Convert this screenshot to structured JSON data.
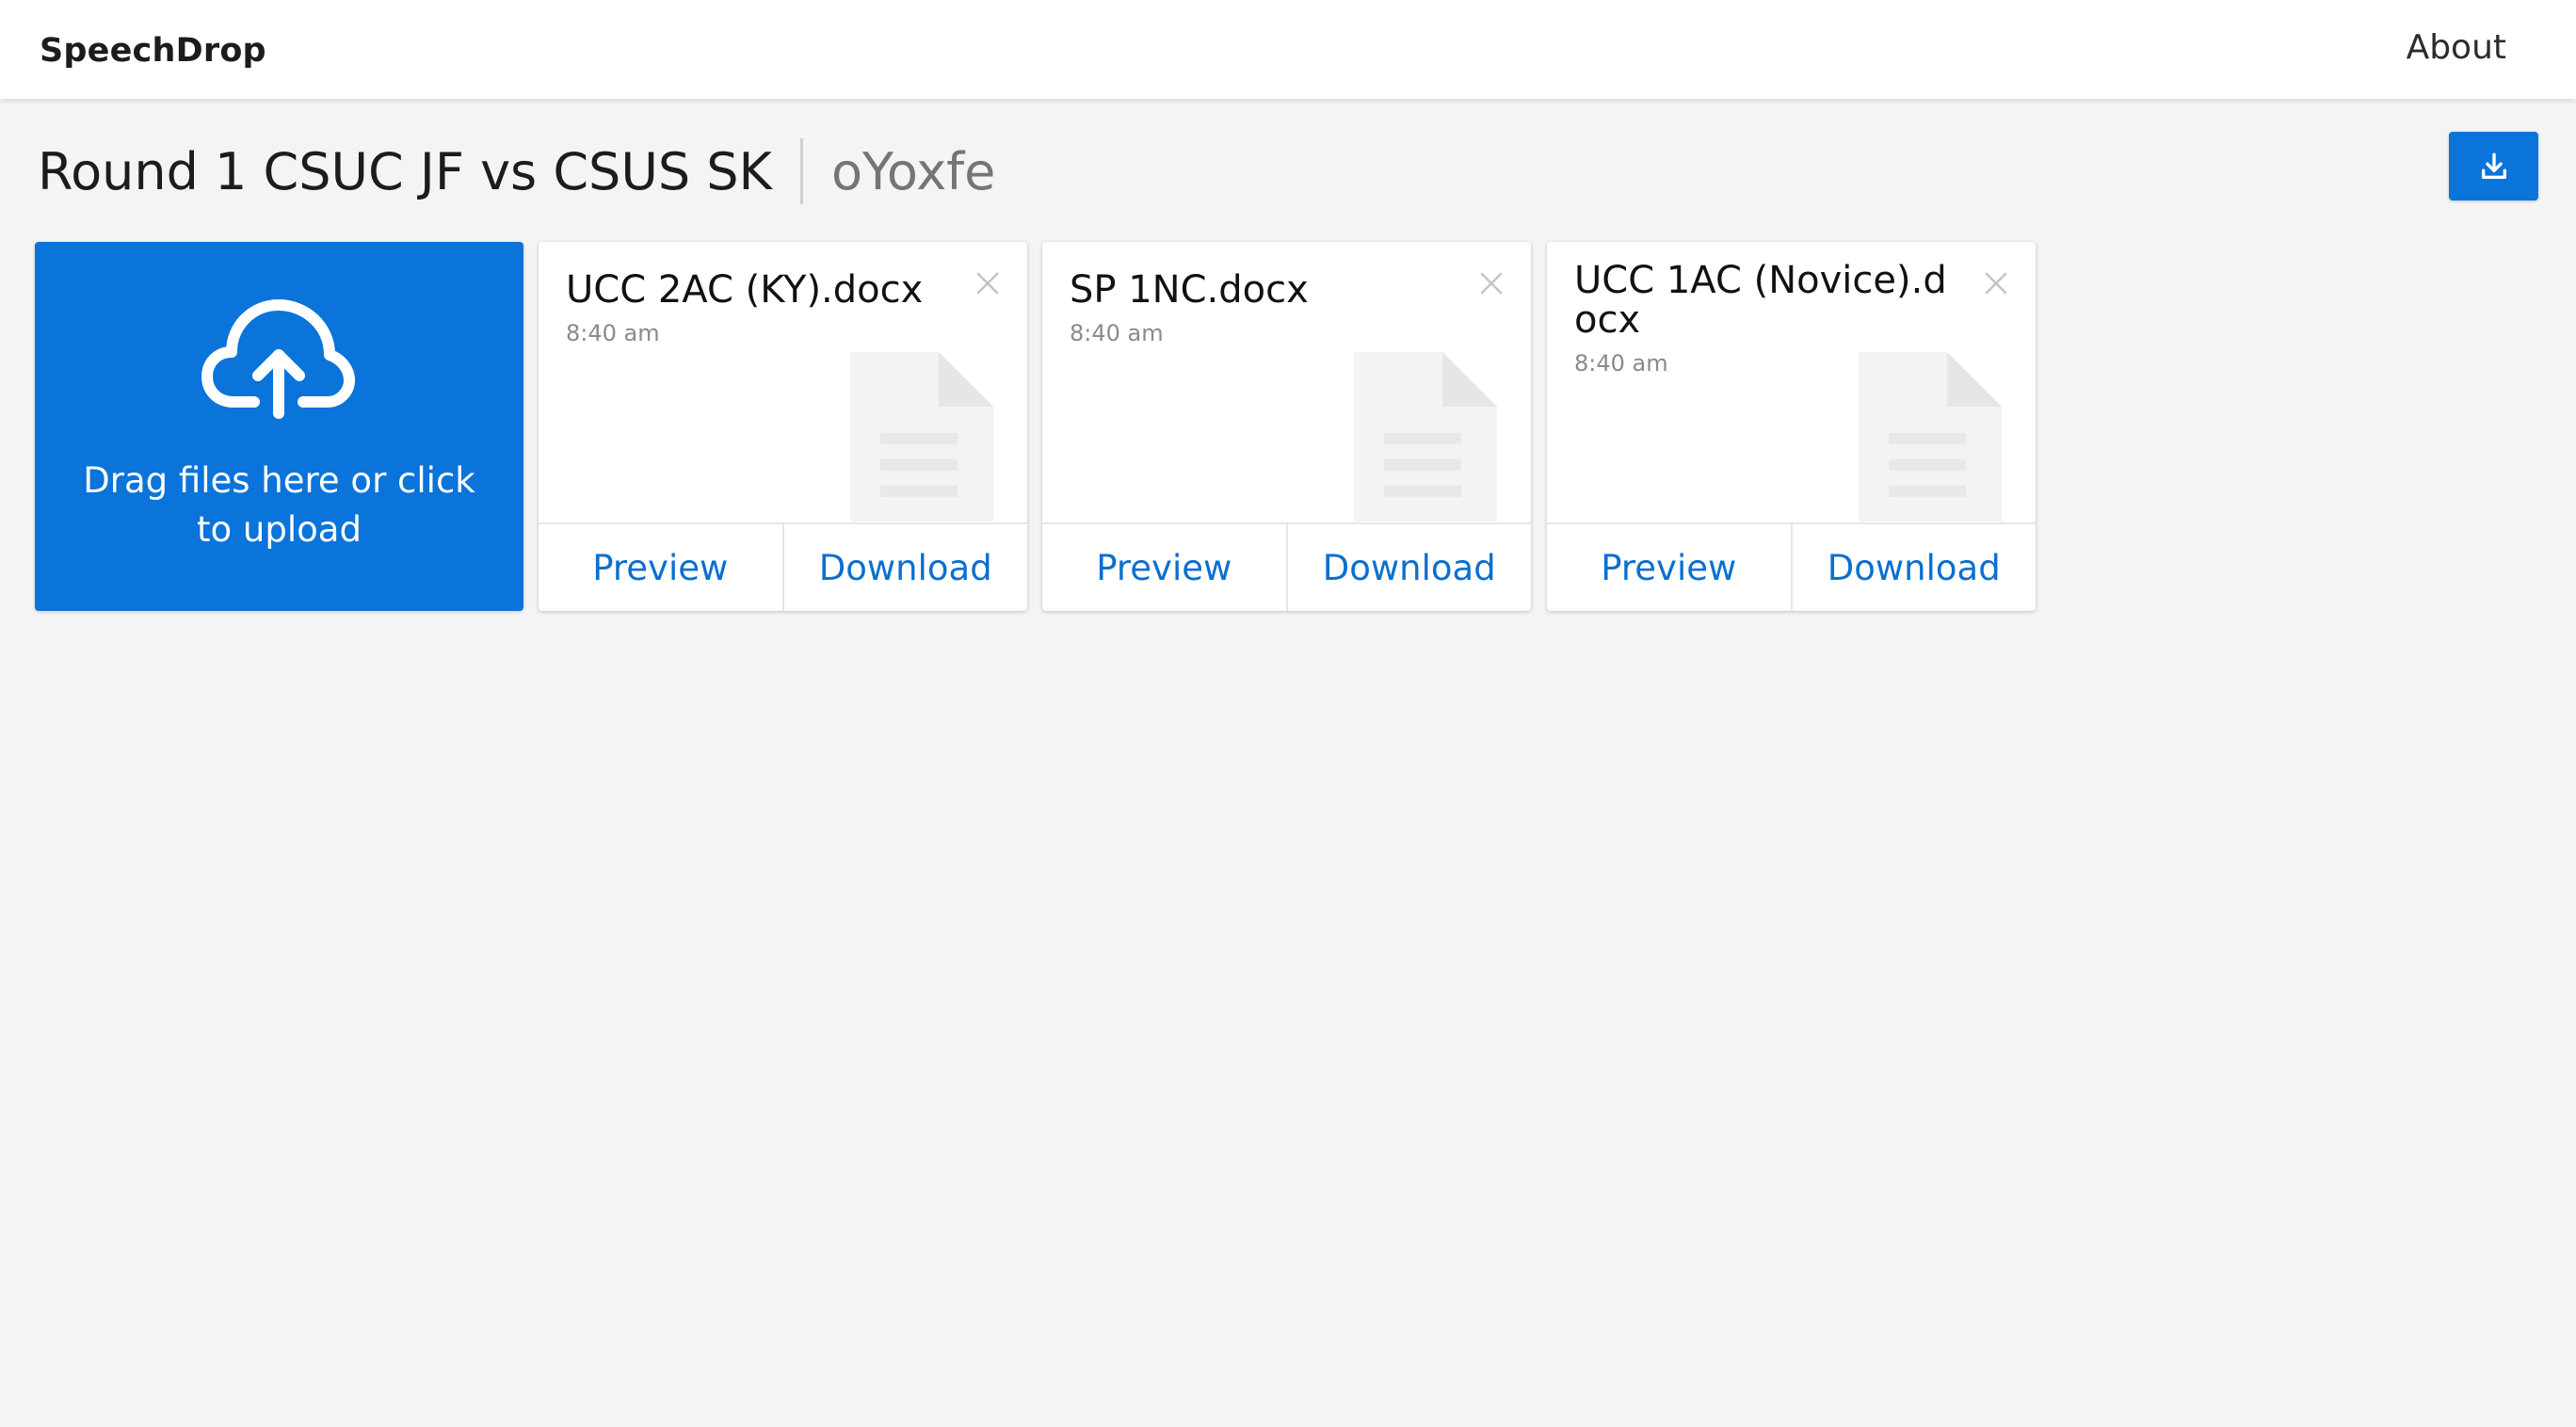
{
  "navbar": {
    "brand": "SpeechDrop",
    "about_label": "About"
  },
  "room": {
    "name": "Round 1 CSUC JF vs CSUS SK",
    "code": "oYoxfe"
  },
  "upload": {
    "text": "Drag files here or click to upload"
  },
  "files": [
    {
      "name": "UCC 2AC (KY).docx",
      "time": "8:40 am",
      "preview_label": "Preview",
      "download_label": "Download"
    },
    {
      "name": "SP 1NC.docx",
      "time": "8:40 am",
      "preview_label": "Preview",
      "download_label": "Download"
    },
    {
      "name": "UCC 1AC (Novice).docx",
      "time": "8:40 am",
      "preview_label": "Preview",
      "download_label": "Download"
    }
  ],
  "colors": {
    "accent": "#0a74da",
    "link": "#0a6fd0",
    "background": "#f4f4f4"
  },
  "icons": {
    "download_all": "download-icon",
    "upload": "cloud-upload-icon",
    "close": "close-icon",
    "file": "document-icon"
  }
}
